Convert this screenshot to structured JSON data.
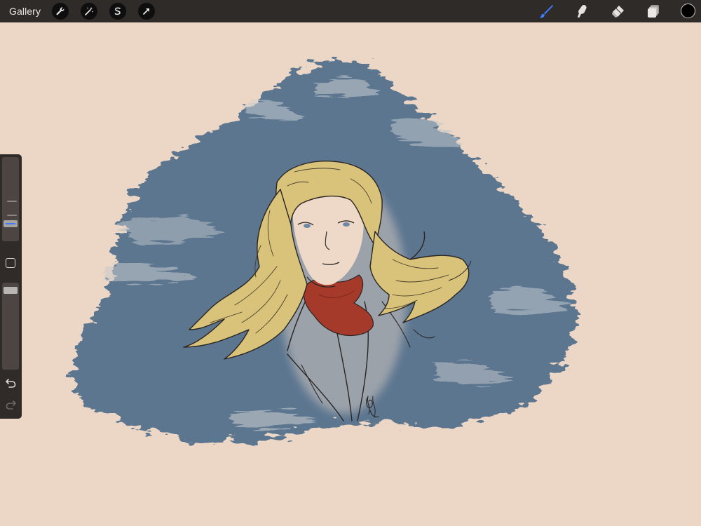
{
  "topbar": {
    "gallery_label": "Gallery",
    "left_tools": [
      "wrench-icon",
      "magic-wand-icon",
      "selection-icon",
      "transform-arrow-icon"
    ],
    "right_tools": [
      "brush-icon",
      "smudge-icon",
      "eraser-icon",
      "layers-icon"
    ],
    "active_tool": "brush",
    "current_color": "#000000",
    "accent_color": "#3f7cff"
  },
  "sidebar": {
    "brush_size_level": 0.15,
    "opacity_level": 0.95
  },
  "canvas": {
    "background_color": "#ecd6c5",
    "wash_color": "#5b7590",
    "hair_color": "#d8c279",
    "scarf_color": "#a63a2b"
  }
}
